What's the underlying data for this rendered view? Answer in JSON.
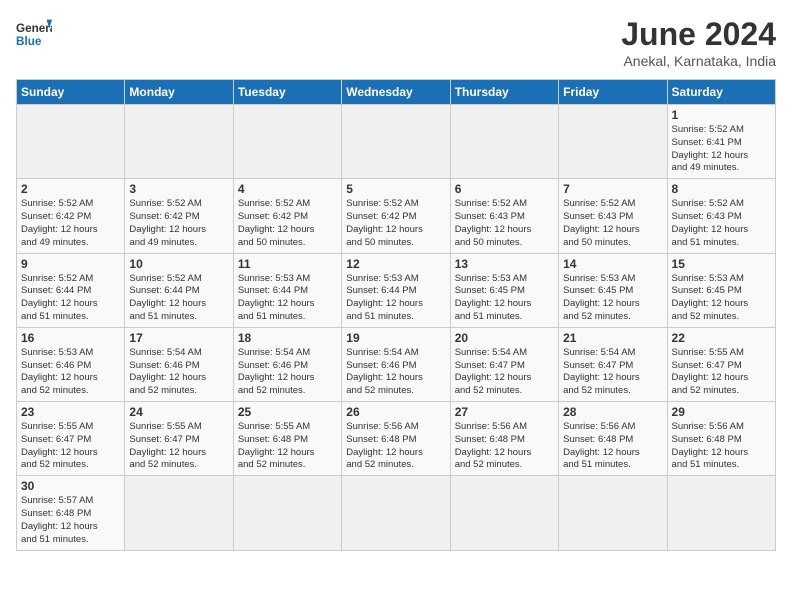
{
  "header": {
    "logo_general": "General",
    "logo_blue": "Blue",
    "title": "June 2024",
    "location": "Anekal, Karnataka, India"
  },
  "days_of_week": [
    "Sunday",
    "Monday",
    "Tuesday",
    "Wednesday",
    "Thursday",
    "Friday",
    "Saturday"
  ],
  "weeks": [
    [
      {
        "day": "",
        "info": ""
      },
      {
        "day": "",
        "info": ""
      },
      {
        "day": "",
        "info": ""
      },
      {
        "day": "",
        "info": ""
      },
      {
        "day": "",
        "info": ""
      },
      {
        "day": "",
        "info": ""
      },
      {
        "day": "1",
        "info": "Sunrise: 5:52 AM\nSunset: 6:41 PM\nDaylight: 12 hours\nand 49 minutes."
      }
    ],
    [
      {
        "day": "2",
        "info": "Sunrise: 5:52 AM\nSunset: 6:42 PM\nDaylight: 12 hours\nand 49 minutes."
      },
      {
        "day": "3",
        "info": "Sunrise: 5:52 AM\nSunset: 6:42 PM\nDaylight: 12 hours\nand 49 minutes."
      },
      {
        "day": "4",
        "info": "Sunrise: 5:52 AM\nSunset: 6:42 PM\nDaylight: 12 hours\nand 50 minutes."
      },
      {
        "day": "5",
        "info": "Sunrise: 5:52 AM\nSunset: 6:42 PM\nDaylight: 12 hours\nand 50 minutes."
      },
      {
        "day": "6",
        "info": "Sunrise: 5:52 AM\nSunset: 6:43 PM\nDaylight: 12 hours\nand 50 minutes."
      },
      {
        "day": "7",
        "info": "Sunrise: 5:52 AM\nSunset: 6:43 PM\nDaylight: 12 hours\nand 50 minutes."
      },
      {
        "day": "8",
        "info": "Sunrise: 5:52 AM\nSunset: 6:43 PM\nDaylight: 12 hours\nand 51 minutes."
      }
    ],
    [
      {
        "day": "9",
        "info": "Sunrise: 5:52 AM\nSunset: 6:44 PM\nDaylight: 12 hours\nand 51 minutes."
      },
      {
        "day": "10",
        "info": "Sunrise: 5:52 AM\nSunset: 6:44 PM\nDaylight: 12 hours\nand 51 minutes."
      },
      {
        "day": "11",
        "info": "Sunrise: 5:53 AM\nSunset: 6:44 PM\nDaylight: 12 hours\nand 51 minutes."
      },
      {
        "day": "12",
        "info": "Sunrise: 5:53 AM\nSunset: 6:44 PM\nDaylight: 12 hours\nand 51 minutes."
      },
      {
        "day": "13",
        "info": "Sunrise: 5:53 AM\nSunset: 6:45 PM\nDaylight: 12 hours\nand 51 minutes."
      },
      {
        "day": "14",
        "info": "Sunrise: 5:53 AM\nSunset: 6:45 PM\nDaylight: 12 hours\nand 52 minutes."
      },
      {
        "day": "15",
        "info": "Sunrise: 5:53 AM\nSunset: 6:45 PM\nDaylight: 12 hours\nand 52 minutes."
      }
    ],
    [
      {
        "day": "16",
        "info": "Sunrise: 5:53 AM\nSunset: 6:46 PM\nDaylight: 12 hours\nand 52 minutes."
      },
      {
        "day": "17",
        "info": "Sunrise: 5:54 AM\nSunset: 6:46 PM\nDaylight: 12 hours\nand 52 minutes."
      },
      {
        "day": "18",
        "info": "Sunrise: 5:54 AM\nSunset: 6:46 PM\nDaylight: 12 hours\nand 52 minutes."
      },
      {
        "day": "19",
        "info": "Sunrise: 5:54 AM\nSunset: 6:46 PM\nDaylight: 12 hours\nand 52 minutes."
      },
      {
        "day": "20",
        "info": "Sunrise: 5:54 AM\nSunset: 6:47 PM\nDaylight: 12 hours\nand 52 minutes."
      },
      {
        "day": "21",
        "info": "Sunrise: 5:54 AM\nSunset: 6:47 PM\nDaylight: 12 hours\nand 52 minutes."
      },
      {
        "day": "22",
        "info": "Sunrise: 5:55 AM\nSunset: 6:47 PM\nDaylight: 12 hours\nand 52 minutes."
      }
    ],
    [
      {
        "day": "23",
        "info": "Sunrise: 5:55 AM\nSunset: 6:47 PM\nDaylight: 12 hours\nand 52 minutes."
      },
      {
        "day": "24",
        "info": "Sunrise: 5:55 AM\nSunset: 6:47 PM\nDaylight: 12 hours\nand 52 minutes."
      },
      {
        "day": "25",
        "info": "Sunrise: 5:55 AM\nSunset: 6:48 PM\nDaylight: 12 hours\nand 52 minutes."
      },
      {
        "day": "26",
        "info": "Sunrise: 5:56 AM\nSunset: 6:48 PM\nDaylight: 12 hours\nand 52 minutes."
      },
      {
        "day": "27",
        "info": "Sunrise: 5:56 AM\nSunset: 6:48 PM\nDaylight: 12 hours\nand 52 minutes."
      },
      {
        "day": "28",
        "info": "Sunrise: 5:56 AM\nSunset: 6:48 PM\nDaylight: 12 hours\nand 51 minutes."
      },
      {
        "day": "29",
        "info": "Sunrise: 5:56 AM\nSunset: 6:48 PM\nDaylight: 12 hours\nand 51 minutes."
      }
    ],
    [
      {
        "day": "30",
        "info": "Sunrise: 5:57 AM\nSunset: 6:48 PM\nDaylight: 12 hours\nand 51 minutes."
      },
      {
        "day": "",
        "info": ""
      },
      {
        "day": "",
        "info": ""
      },
      {
        "day": "",
        "info": ""
      },
      {
        "day": "",
        "info": ""
      },
      {
        "day": "",
        "info": ""
      },
      {
        "day": "",
        "info": ""
      }
    ]
  ]
}
